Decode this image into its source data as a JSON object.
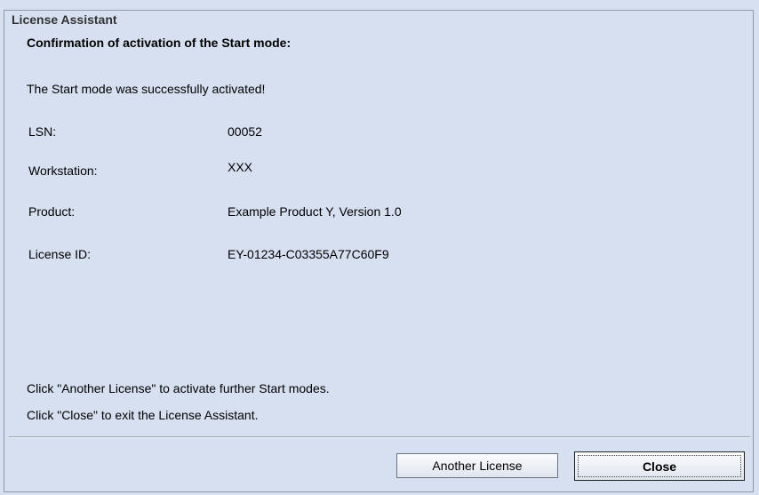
{
  "dialog": {
    "title": "License Assistant",
    "heading": "Confirmation of activation of the Start mode:",
    "message": "The Start mode was successfully activated!"
  },
  "details": [
    {
      "label": "LSN:",
      "value": "00052"
    },
    {
      "label": "Workstation:",
      "value": "XXX"
    },
    {
      "label": "Product:",
      "value": "Example Product Y, Version  1.0"
    },
    {
      "label": "License ID:",
      "value": "EY-01234-C03355A77C60F9"
    }
  ],
  "instructions": {
    "line1": "Click \"Another License\" to activate further Start modes.",
    "line2": "Click \"Close\" to exit the License Assistant."
  },
  "buttons": {
    "another_license": "Another License",
    "close": "Close"
  },
  "colors": {
    "background": "#d6e0f0",
    "border": "#8f98a6"
  }
}
